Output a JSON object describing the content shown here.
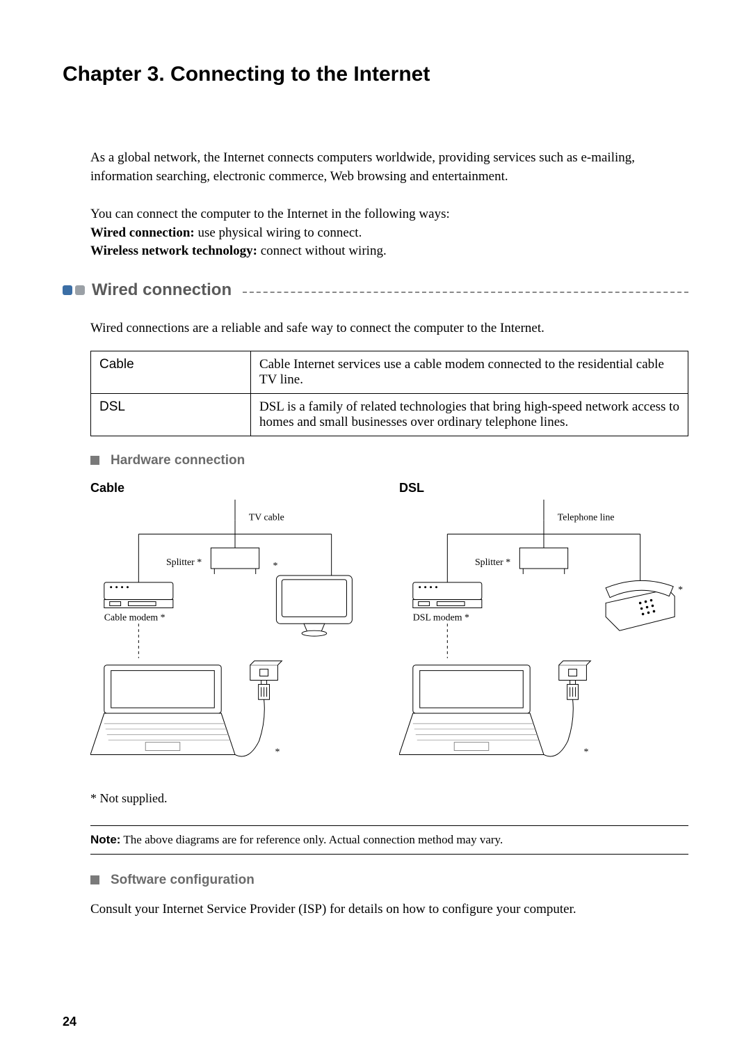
{
  "chapter_title": "Chapter 3. Connecting to the Internet",
  "intro": "As a global network, the Internet connects computers worldwide, providing services such as e-mailing, information searching, electronic commerce, Web browsing and entertainment.",
  "ways_intro": "You can connect the computer to the Internet in the following ways:",
  "wired_label": "Wired connection:",
  "wired_desc": " use physical wiring to connect.",
  "wireless_label": "Wireless network technology:",
  "wireless_desc": " connect without wiring.",
  "section_wired": "Wired connection",
  "wired_body": "Wired connections are a reliable and safe way to connect the computer to the Internet.",
  "table": {
    "rows": [
      {
        "name": "Cable",
        "desc": "Cable Internet services use a cable modem connected to the residential cable TV line."
      },
      {
        "name": "DSL",
        "desc": "DSL is a family of related technologies that bring high-speed network access to homes and small businesses over ordinary telephone lines."
      }
    ]
  },
  "sub_hardware": "Hardware connection",
  "diagram_cable_title": "Cable",
  "diagram_dsl_title": "DSL",
  "labels": {
    "tv_cable": "TV cable",
    "telephone_line": "Telephone line",
    "splitter": "Splitter *",
    "cable_modem": "Cable modem *",
    "dsl_modem": "DSL modem *",
    "star": "*"
  },
  "footnote": "* Not supplied.",
  "note_label": "Note:",
  "note_text": " The above diagrams are for reference only. Actual connection method may vary.",
  "sub_software": "Software configuration",
  "software_body": "Consult your Internet Service Provider (ISP) for details on how to configure your computer.",
  "page_number": "24"
}
